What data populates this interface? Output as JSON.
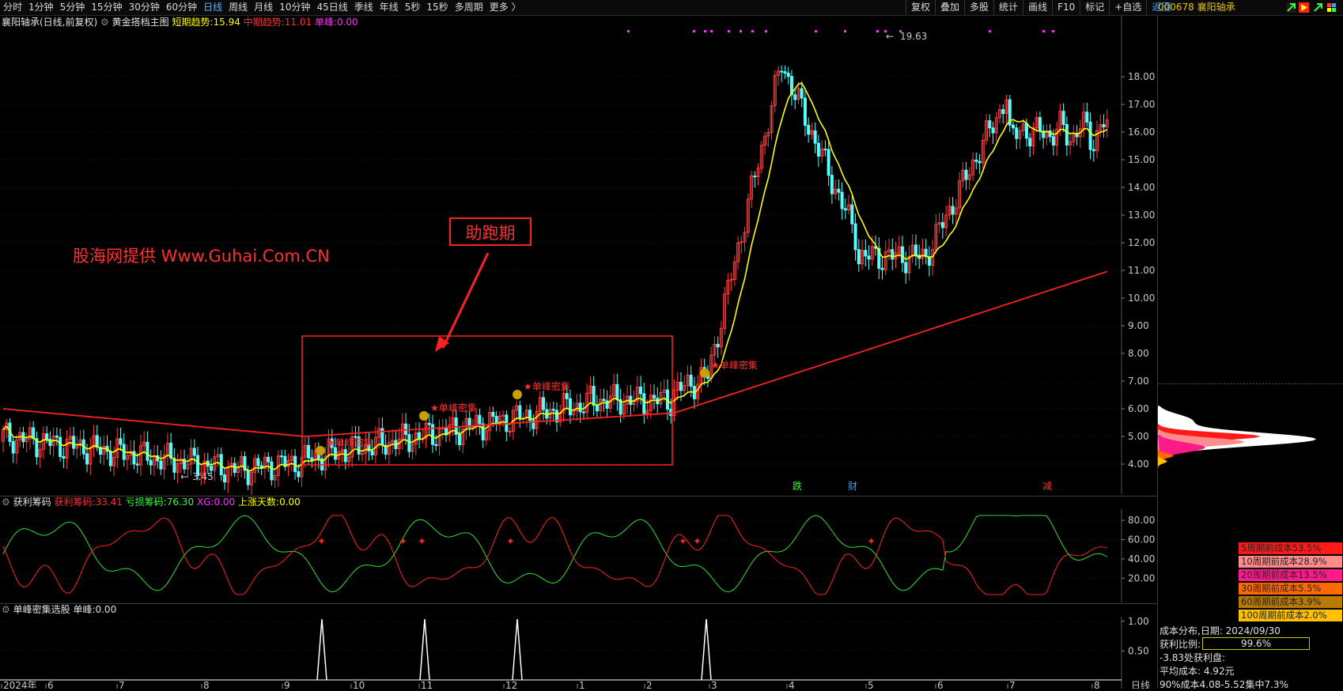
{
  "toolbar": {
    "tabs": [
      "分时",
      "1分钟",
      "5分钟",
      "15分钟",
      "30分钟",
      "60分钟",
      "日线",
      "周线",
      "月线",
      "10分钟",
      "45日线",
      "季线",
      "年线",
      "5秒",
      "15秒",
      "多周期",
      "更多 〉"
    ],
    "active_tab": "日线",
    "tools": [
      "复权",
      "叠加",
      "多股",
      "统计",
      "画线",
      "F10",
      "标记",
      "+自选",
      "返回"
    ],
    "stock_code": "000678",
    "stock_name": "襄阳轴承"
  },
  "main_panel": {
    "title": "襄阳轴承(日线,前复权)",
    "indicator_name": "黄金搭档主图",
    "short_trend_label": "短期趋势:",
    "short_trend_value": "15.94",
    "mid_trend_label": "中期趋势:",
    "mid_trend_value": "11.01",
    "single_peak_label": "单峰:",
    "single_peak_value": "0.00",
    "watermark": "股海网提供 Www.Guhai.Com.CN",
    "annotation_box_label": "助跑期",
    "high_label": "19.63",
    "low_label": "3.45",
    "signal_label": "★单峰密集",
    "event_labels": [
      "跌",
      "财",
      "减"
    ],
    "y_ticks": [
      "18.00",
      "17.00",
      "16.00",
      "15.00",
      "14.00",
      "13.00",
      "12.00",
      "11.00",
      "10.00",
      "9.00",
      "8.00",
      "7.00",
      "6.00",
      "5.00",
      "4.00"
    ],
    "colors": {
      "up": "#ff3c3c",
      "down": "#54ffff",
      "short_trend": "#ffff00",
      "mid_trend": "#ff2020",
      "box": "#ff2020"
    }
  },
  "profit_panel": {
    "name": "获利筹码",
    "profit_label": "获利筹码:",
    "profit_value": "33.41",
    "loss_label": "亏损筹码:",
    "loss_value": "76.30",
    "xg_label": "XG:",
    "xg_value": "0.00",
    "rise_days_label": "上涨天数:",
    "rise_days_value": "0.00",
    "y_ticks": [
      "80.00",
      "60.00",
      "40.00",
      "20.00"
    ]
  },
  "peak_panel": {
    "name": "单峰密集选股",
    "peak_label": "单峰:",
    "peak_value": "0.00",
    "y_ticks": [
      "1.00",
      "0.50"
    ]
  },
  "x_axis": {
    "labels": [
      "2024年",
      "6",
      "7",
      "8",
      "9",
      "10",
      "11",
      "12",
      "1",
      "2",
      "3",
      "4",
      "5",
      "6",
      "7",
      "8"
    ],
    "period": "日线"
  },
  "cost_distribution": {
    "rows": [
      {
        "text": "5周期前成本53.5%",
        "color": "#ff1a1a"
      },
      {
        "text": "10周期前成本28.9%",
        "color": "#ff8c8c"
      },
      {
        "text": "20周期前成本13.5%",
        "color": "#ff1a8c"
      },
      {
        "text": "30周期前成本5.5%",
        "color": "#ff6a00"
      },
      {
        "text": "60周期前成本3.9%",
        "color": "#b87a00"
      },
      {
        "text": "100周期前成本2.0%",
        "color": "#ffc000"
      }
    ],
    "date_line": "成本分布,日期: 2024/09/30",
    "profit_ratio_label": "获利比例:",
    "profit_ratio_value": "99.6%",
    "profit_plate": "-3.83处获利盘:",
    "avg_cost": "平均成本: 4.92元",
    "concentration": "90%成本4.08-5.52集中7.3%"
  }
}
